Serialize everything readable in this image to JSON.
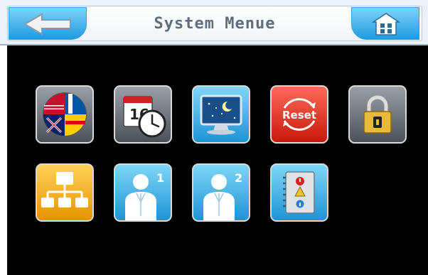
{
  "header": {
    "title": "System Menue",
    "back_icon": "arrow-left-icon",
    "home_icon": "home-icon"
  },
  "menu": {
    "rows": [
      [
        {
          "id": "language",
          "icon": "flags-globe-icon",
          "style": "gray"
        },
        {
          "id": "date-time",
          "icon": "calendar-clock-icon",
          "style": "gray",
          "label": "16"
        },
        {
          "id": "display",
          "icon": "monitor-night-icon",
          "style": "blue"
        },
        {
          "id": "reset",
          "icon": "reset-icon",
          "style": "red",
          "label": "Reset"
        },
        {
          "id": "lock",
          "icon": "padlock-icon",
          "style": "gray"
        }
      ],
      [
        {
          "id": "network",
          "icon": "network-tree-icon",
          "style": "orange"
        },
        {
          "id": "user-1",
          "icon": "user-1-icon",
          "style": "blue",
          "label": "1"
        },
        {
          "id": "user-2",
          "icon": "user-2-icon",
          "style": "blue",
          "label": "2"
        },
        {
          "id": "log",
          "icon": "notebook-alerts-icon",
          "style": "blue"
        }
      ]
    ]
  },
  "colors": {
    "background": "#000000",
    "accent_blue": "#1e9be3",
    "header_bg": "#eaf1f7",
    "title_text": "#5e6e7c"
  }
}
